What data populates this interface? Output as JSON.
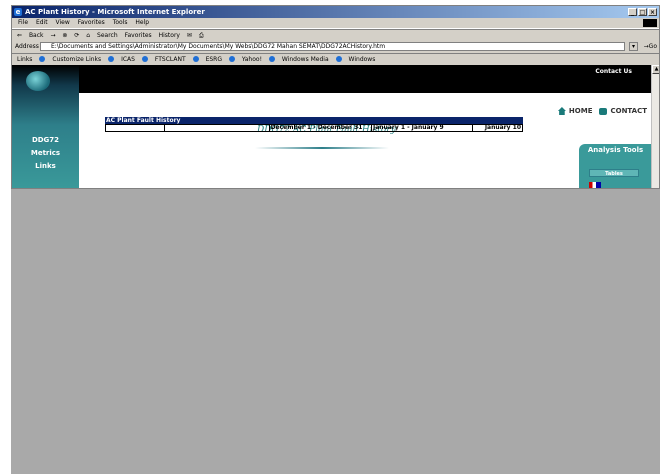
{
  "window": {
    "title": "AC Plant History - Microsoft Internet Explorer",
    "controls": [
      "_",
      "□",
      "×"
    ]
  },
  "menu": [
    "File",
    "Edit",
    "View",
    "Favorites",
    "Tools",
    "Help"
  ],
  "toolbar": {
    "back": "Back",
    "forward": "→",
    "search": "Search",
    "favorites": "Favorites",
    "history": "History"
  },
  "address": {
    "label": "Address",
    "value": "E:\\Documents and Settings\\Administrator\\My Documents\\My Webs\\DDG72 Mahan SEMAT\\DDG72ACHistory.htm",
    "go": "Go"
  },
  "links": {
    "label": "Links",
    "items": [
      "Customize Links",
      "ICAS",
      "FTSCLANT",
      "ESRG",
      "Yahoo!",
      "Windows Media",
      "Windows"
    ]
  },
  "page": {
    "contact_us": "Contact Us",
    "sidebar": [
      "DDG72",
      "Metrics",
      "Links"
    ],
    "title": "DDG72 AC Plant Fault History",
    "home": "HOME",
    "contact": "CONTACT",
    "analysis_tools": "Analysis Tools",
    "tables_button": "Tables"
  },
  "table": {
    "caption": "AC Plant Fault History",
    "headers": [
      "",
      "",
      "December 1 - December 31",
      "January 1 - January 9",
      "January 10"
    ]
  }
}
